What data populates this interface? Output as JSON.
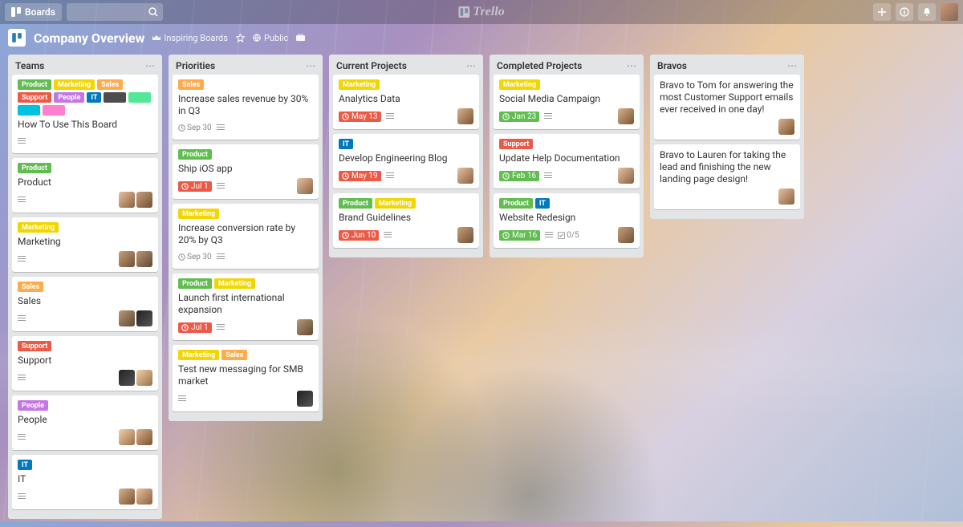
{
  "topbar": {
    "boards_label": "Boards",
    "brand": "Trello"
  },
  "board_header": {
    "title": "Company Overview",
    "inspiring": "Inspiring Boards",
    "visibility": "Public"
  },
  "label_colors": {
    "Product": "lbl-green",
    "Marketing": "lbl-yellow",
    "Sales": "lbl-orange",
    "Support": "lbl-red",
    "People": "lbl-purple",
    "IT": "lbl-blue"
  },
  "lists": [
    {
      "title": "Teams",
      "cards": [
        {
          "labels": [
            "Product",
            "Marketing",
            "Sales",
            "Support",
            "People",
            "IT"
          ],
          "extra_color_labels": [
            "lbl-black",
            "lbl-lime",
            "lbl-sky",
            "lbl-pink"
          ],
          "title": "How To Use This Board",
          "badges": {
            "desc": true
          }
        },
        {
          "labels": [
            "Product"
          ],
          "title": "Product",
          "badges": {
            "desc": true
          },
          "members": 2
        },
        {
          "labels": [
            "Marketing"
          ],
          "title": "Marketing",
          "badges": {
            "desc": true
          },
          "members": 2
        },
        {
          "labels": [
            "Sales"
          ],
          "title": "Sales",
          "badges": {
            "desc": true
          },
          "members": 2
        },
        {
          "labels": [
            "Support"
          ],
          "title": "Support",
          "badges": {
            "desc": true
          },
          "members": 2
        },
        {
          "labels": [
            "People"
          ],
          "title": "People",
          "badges": {
            "desc": true
          },
          "members": 2
        },
        {
          "labels": [
            "IT"
          ],
          "title": "IT",
          "badges": {
            "desc": true
          },
          "members": 2
        }
      ]
    },
    {
      "title": "Priorities",
      "cards": [
        {
          "labels": [
            "Sales"
          ],
          "title": "Increase sales revenue by 30% in Q3",
          "badges": {
            "due": "Sep 30",
            "due_color": "plain",
            "desc": true
          }
        },
        {
          "labels": [
            "Product"
          ],
          "title": "Ship iOS app",
          "badges": {
            "due": "Jul 1",
            "due_color": "red",
            "desc": true
          },
          "members": 1
        },
        {
          "labels": [
            "Marketing"
          ],
          "title": "Increase conversion rate by 20% by Q3",
          "badges": {
            "due": "Sep 30",
            "due_color": "plain",
            "desc": true
          }
        },
        {
          "labels": [
            "Product",
            "Marketing"
          ],
          "title": "Launch first international expansion",
          "badges": {
            "due": "Jul 1",
            "due_color": "red",
            "desc": true
          },
          "members": 1
        },
        {
          "labels": [
            "Marketing",
            "Sales"
          ],
          "title": "Test new messaging for SMB market",
          "badges": {
            "desc": true
          },
          "members": 1
        }
      ]
    },
    {
      "title": "Current Projects",
      "cards": [
        {
          "labels": [
            "Marketing"
          ],
          "title": "Analytics Data",
          "badges": {
            "due": "May 13",
            "due_color": "red",
            "desc": true
          },
          "members": 1
        },
        {
          "labels": [
            "IT"
          ],
          "title": "Develop Engineering Blog",
          "badges": {
            "due": "May 19",
            "due_color": "red",
            "desc": true
          },
          "members": 1
        },
        {
          "labels": [
            "Product",
            "Marketing"
          ],
          "title": "Brand Guidelines",
          "badges": {
            "due": "Jun 10",
            "due_color": "red",
            "desc": true
          },
          "members": 1
        }
      ]
    },
    {
      "title": "Completed Projects",
      "cards": [
        {
          "labels": [
            "Marketing"
          ],
          "title": "Social Media Campaign",
          "badges": {
            "due": "Jan 23",
            "due_color": "green",
            "desc": true
          },
          "members": 1
        },
        {
          "labels": [
            "Support"
          ],
          "title": "Update Help Documentation",
          "badges": {
            "due": "Feb 16",
            "due_color": "green",
            "desc": true
          },
          "members": 1
        },
        {
          "labels": [
            "Product",
            "IT"
          ],
          "title": "Website Redesign",
          "badges": {
            "due": "Mar 16",
            "due_color": "green",
            "desc": true,
            "check": "0/5"
          },
          "members": 1
        }
      ]
    },
    {
      "title": "Bravos",
      "cards": [
        {
          "title": "Bravo to Tom for answering the most Customer Support emails ever received in one day!",
          "members": 1
        },
        {
          "title": "Bravo to Lauren for taking the lead and finishing the new landing page design!",
          "members": 1
        }
      ]
    }
  ]
}
